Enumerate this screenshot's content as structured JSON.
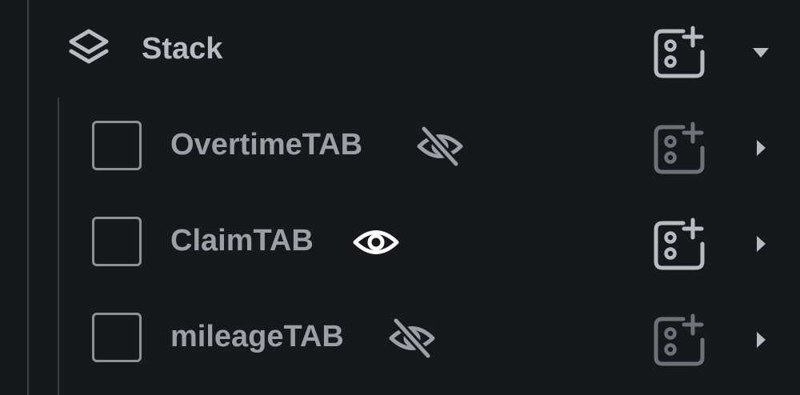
{
  "tree": {
    "parent": {
      "label": "Stack",
      "icon": "layers-icon",
      "expanded": true,
      "add_icon": "add-component-icon",
      "toggle_icon": "chevron-down-icon",
      "label_color": "#b7bcc2"
    },
    "children": [
      {
        "label": "OvertimeTAB",
        "checked": false,
        "visibility_icon": "eye-off-icon",
        "visible": false,
        "add_icon": "add-component-icon",
        "toggle_icon": "chevron-right-icon"
      },
      {
        "label": "ClaimTAB",
        "checked": false,
        "visibility_icon": "eye-icon",
        "visible": true,
        "add_icon": "add-component-icon",
        "toggle_icon": "chevron-right-icon"
      },
      {
        "label": "mileageTAB",
        "checked": false,
        "visibility_icon": "eye-off-icon",
        "visible": false,
        "add_icon": "add-component-icon",
        "toggle_icon": "chevron-right-icon"
      }
    ]
  },
  "colors": {
    "background": "#16181b",
    "guide_line": "#3a3d42",
    "text_primary": "#b7bcc2",
    "text_secondary": "#9aa0a6",
    "icon_bright": "#ffffff",
    "icon_muted": "#6e7278",
    "icon_strong": "#b7bcc2"
  }
}
